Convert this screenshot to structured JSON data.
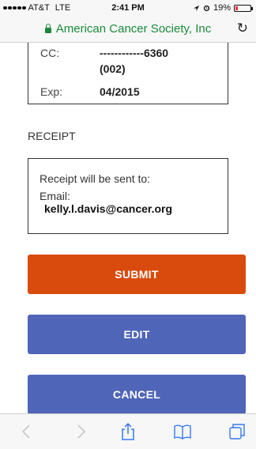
{
  "status_bar": {
    "carrier": "AT&T",
    "network": "LTE",
    "time": "2:41 PM",
    "battery_percent": "19%",
    "battery_level": 0.19
  },
  "url_bar": {
    "site": "American Cancer Society, Inc"
  },
  "card": {
    "cc_label": "CC:",
    "cc_value": "------------6360",
    "cc_value_line2": "(002)",
    "exp_label": "Exp:",
    "exp_value": "04/2015"
  },
  "receipt": {
    "section_title": "RECEIPT",
    "sent_to_text": "Receipt will be sent to:",
    "email_label": "Email:",
    "email_value": "kelly.l.davis@cancer.org"
  },
  "buttons": {
    "submit": "SUBMIT",
    "edit": "EDIT",
    "cancel": "CANCEL"
  },
  "colors": {
    "submit": "#d94b0d",
    "edit": "#4f65b8",
    "cancel": "#4f65b8",
    "secure_green": "#1a8a3a"
  }
}
